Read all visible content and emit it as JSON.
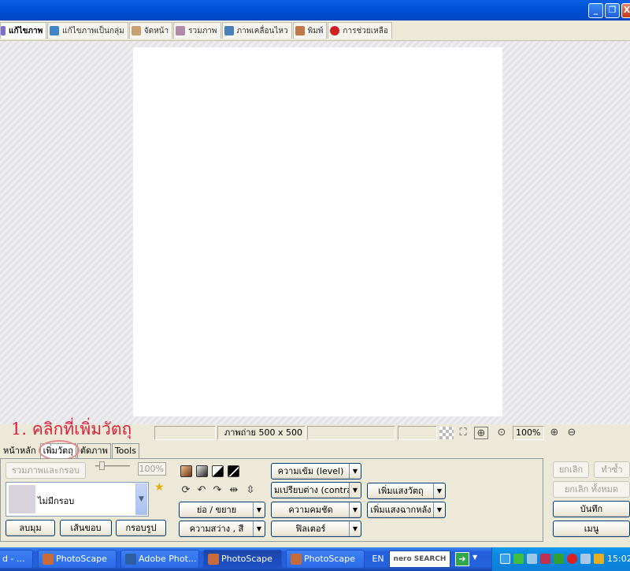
{
  "titlebar": {
    "minimize": "_",
    "restore": "❐",
    "close": "X"
  },
  "top_tabs": [
    {
      "label": "แก้ไขภาพ",
      "color": "#7a6fd0"
    },
    {
      "label": "แก้ไขภาพเป็นกลุ่ม",
      "color": "#3f86c8"
    },
    {
      "label": "จัดหน้า",
      "color": "#c9a070"
    },
    {
      "label": "รวมภาพ",
      "color": "#b08aa6"
    },
    {
      "label": "ภาพเคลื่อนไหว",
      "color": "#4a80b8"
    },
    {
      "label": "พิมพ์",
      "color": "#c07848"
    },
    {
      "label": "การช่วยเหลือ",
      "color": "#d02020"
    }
  ],
  "status": {
    "photo_size": "ภาพถ่าย 500 x 500",
    "zoom": "100%"
  },
  "annotation": "1. คลิกที่เพิ่มวัตถุ",
  "panel_tabs": [
    "หน้าหลัก",
    "เพิ่มวัตถุ",
    "ตัดภาพ",
    "Tools"
  ],
  "panel": {
    "merge_frame": "รวมภาพและกรอบ",
    "frame_pct": "100%",
    "frame_select": "ไม่มีกรอบ",
    "round_corner": "ลบมุม",
    "border_line": "เส้นขอบ",
    "frame_shape": "กรอบรูป",
    "resize": "ย่อ / ขยาย",
    "brightness": "ความสว่าง , สี",
    "level": "ความเข้ม (level)",
    "contrast": "มเปรียบต่าง (contra",
    "sharpen": "ความคมชัด",
    "filter": "ฟิลเตอร์",
    "add_object_light": "เพิ่มแสงวัตถุ",
    "add_backlight": "เพิ่มแสงฉากหลัง"
  },
  "right_panel": {
    "undo": "ยกเลิก",
    "redo": "ทำซ้ำ",
    "undo_all": "ยกเลิก ทั้งหมด",
    "save": "บันทึก",
    "menu": "เมนู"
  },
  "taskbar": {
    "items": [
      {
        "label": "d - ...",
        "color": "#ffffff"
      },
      {
        "label": "PhotoScape",
        "color": "#c86b3a"
      },
      {
        "label": "Adobe Phot...",
        "color": "#2d5f9e"
      },
      {
        "label": "PhotoScape",
        "color": "#c86b3a"
      },
      {
        "label": "PhotoScape",
        "color": "#c86b3a"
      }
    ],
    "lang": "EN",
    "search_brand": "nero SEARCH",
    "clock": "15:02"
  }
}
